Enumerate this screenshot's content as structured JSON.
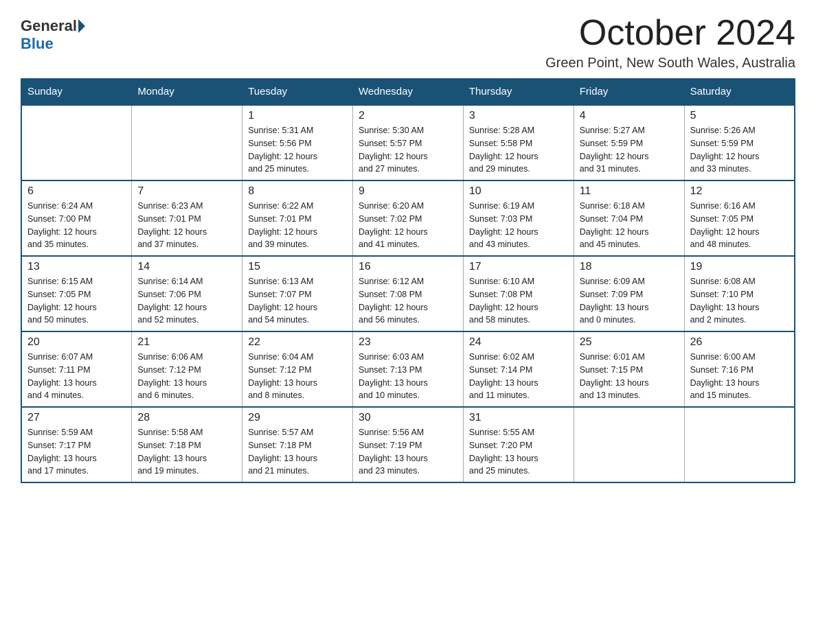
{
  "header": {
    "logo": {
      "part1": "General",
      "part2": "Blue"
    },
    "title": "October 2024",
    "location": "Green Point, New South Wales, Australia"
  },
  "columns": [
    "Sunday",
    "Monday",
    "Tuesday",
    "Wednesday",
    "Thursday",
    "Friday",
    "Saturday"
  ],
  "weeks": [
    [
      {
        "day": "",
        "info": ""
      },
      {
        "day": "",
        "info": ""
      },
      {
        "day": "1",
        "info": "Sunrise: 5:31 AM\nSunset: 5:56 PM\nDaylight: 12 hours\nand 25 minutes."
      },
      {
        "day": "2",
        "info": "Sunrise: 5:30 AM\nSunset: 5:57 PM\nDaylight: 12 hours\nand 27 minutes."
      },
      {
        "day": "3",
        "info": "Sunrise: 5:28 AM\nSunset: 5:58 PM\nDaylight: 12 hours\nand 29 minutes."
      },
      {
        "day": "4",
        "info": "Sunrise: 5:27 AM\nSunset: 5:59 PM\nDaylight: 12 hours\nand 31 minutes."
      },
      {
        "day": "5",
        "info": "Sunrise: 5:26 AM\nSunset: 5:59 PM\nDaylight: 12 hours\nand 33 minutes."
      }
    ],
    [
      {
        "day": "6",
        "info": "Sunrise: 6:24 AM\nSunset: 7:00 PM\nDaylight: 12 hours\nand 35 minutes."
      },
      {
        "day": "7",
        "info": "Sunrise: 6:23 AM\nSunset: 7:01 PM\nDaylight: 12 hours\nand 37 minutes."
      },
      {
        "day": "8",
        "info": "Sunrise: 6:22 AM\nSunset: 7:01 PM\nDaylight: 12 hours\nand 39 minutes."
      },
      {
        "day": "9",
        "info": "Sunrise: 6:20 AM\nSunset: 7:02 PM\nDaylight: 12 hours\nand 41 minutes."
      },
      {
        "day": "10",
        "info": "Sunrise: 6:19 AM\nSunset: 7:03 PM\nDaylight: 12 hours\nand 43 minutes."
      },
      {
        "day": "11",
        "info": "Sunrise: 6:18 AM\nSunset: 7:04 PM\nDaylight: 12 hours\nand 45 minutes."
      },
      {
        "day": "12",
        "info": "Sunrise: 6:16 AM\nSunset: 7:05 PM\nDaylight: 12 hours\nand 48 minutes."
      }
    ],
    [
      {
        "day": "13",
        "info": "Sunrise: 6:15 AM\nSunset: 7:05 PM\nDaylight: 12 hours\nand 50 minutes."
      },
      {
        "day": "14",
        "info": "Sunrise: 6:14 AM\nSunset: 7:06 PM\nDaylight: 12 hours\nand 52 minutes."
      },
      {
        "day": "15",
        "info": "Sunrise: 6:13 AM\nSunset: 7:07 PM\nDaylight: 12 hours\nand 54 minutes."
      },
      {
        "day": "16",
        "info": "Sunrise: 6:12 AM\nSunset: 7:08 PM\nDaylight: 12 hours\nand 56 minutes."
      },
      {
        "day": "17",
        "info": "Sunrise: 6:10 AM\nSunset: 7:08 PM\nDaylight: 12 hours\nand 58 minutes."
      },
      {
        "day": "18",
        "info": "Sunrise: 6:09 AM\nSunset: 7:09 PM\nDaylight: 13 hours\nand 0 minutes."
      },
      {
        "day": "19",
        "info": "Sunrise: 6:08 AM\nSunset: 7:10 PM\nDaylight: 13 hours\nand 2 minutes."
      }
    ],
    [
      {
        "day": "20",
        "info": "Sunrise: 6:07 AM\nSunset: 7:11 PM\nDaylight: 13 hours\nand 4 minutes."
      },
      {
        "day": "21",
        "info": "Sunrise: 6:06 AM\nSunset: 7:12 PM\nDaylight: 13 hours\nand 6 minutes."
      },
      {
        "day": "22",
        "info": "Sunrise: 6:04 AM\nSunset: 7:12 PM\nDaylight: 13 hours\nand 8 minutes."
      },
      {
        "day": "23",
        "info": "Sunrise: 6:03 AM\nSunset: 7:13 PM\nDaylight: 13 hours\nand 10 minutes."
      },
      {
        "day": "24",
        "info": "Sunrise: 6:02 AM\nSunset: 7:14 PM\nDaylight: 13 hours\nand 11 minutes."
      },
      {
        "day": "25",
        "info": "Sunrise: 6:01 AM\nSunset: 7:15 PM\nDaylight: 13 hours\nand 13 minutes."
      },
      {
        "day": "26",
        "info": "Sunrise: 6:00 AM\nSunset: 7:16 PM\nDaylight: 13 hours\nand 15 minutes."
      }
    ],
    [
      {
        "day": "27",
        "info": "Sunrise: 5:59 AM\nSunset: 7:17 PM\nDaylight: 13 hours\nand 17 minutes."
      },
      {
        "day": "28",
        "info": "Sunrise: 5:58 AM\nSunset: 7:18 PM\nDaylight: 13 hours\nand 19 minutes."
      },
      {
        "day": "29",
        "info": "Sunrise: 5:57 AM\nSunset: 7:18 PM\nDaylight: 13 hours\nand 21 minutes."
      },
      {
        "day": "30",
        "info": "Sunrise: 5:56 AM\nSunset: 7:19 PM\nDaylight: 13 hours\nand 23 minutes."
      },
      {
        "day": "31",
        "info": "Sunrise: 5:55 AM\nSunset: 7:20 PM\nDaylight: 13 hours\nand 25 minutes."
      },
      {
        "day": "",
        "info": ""
      },
      {
        "day": "",
        "info": ""
      }
    ]
  ]
}
